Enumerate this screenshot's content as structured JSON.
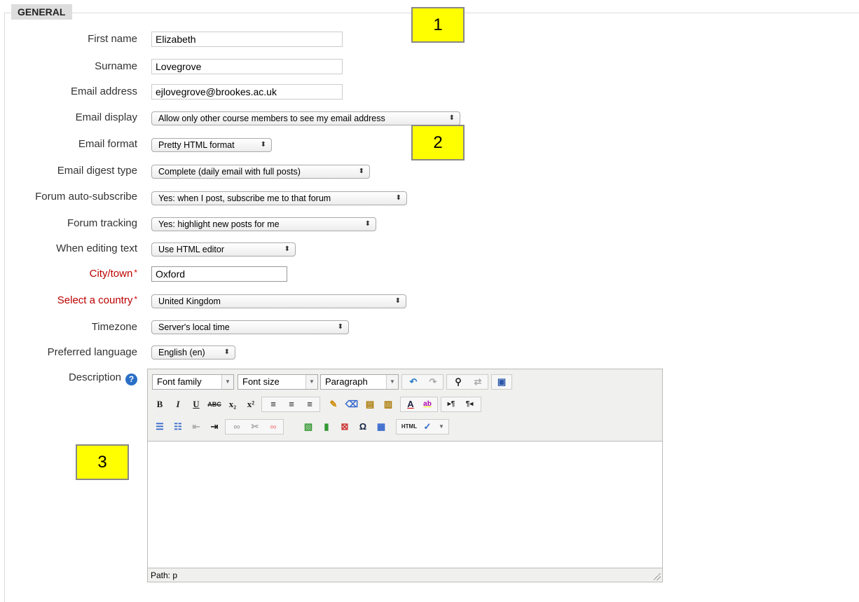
{
  "section": {
    "legend": "GENERAL"
  },
  "fields": {
    "first_name": {
      "label": "First name",
      "value": "Elizabeth"
    },
    "surname": {
      "label": "Surname",
      "value": "Lovegrove"
    },
    "email": {
      "label": "Email address",
      "value": "ejlovegrove@brookes.ac.uk"
    },
    "email_display": {
      "label": "Email display",
      "value": "Allow only other course members to see my email address"
    },
    "email_format": {
      "label": "Email format",
      "value": "Pretty HTML format"
    },
    "digest": {
      "label": "Email digest type",
      "value": "Complete (daily email with full posts)"
    },
    "autosub": {
      "label": "Forum auto-subscribe",
      "value": "Yes: when I post, subscribe me to that forum"
    },
    "tracking": {
      "label": "Forum tracking",
      "value": "Yes: highlight new posts for me"
    },
    "editing": {
      "label": "When editing text",
      "value": "Use HTML editor"
    },
    "city": {
      "label": "City/town",
      "value": "Oxford",
      "required_mark": "*"
    },
    "country": {
      "label": "Select a country",
      "value": "United Kingdom",
      "required_mark": "*"
    },
    "timezone": {
      "label": "Timezone",
      "value": "Server's local time"
    },
    "language": {
      "label": "Preferred language",
      "value": "English (en)"
    },
    "description": {
      "label": "Description",
      "help_icon": "?"
    }
  },
  "editor": {
    "font_family": "Font family",
    "font_size": "Font size",
    "format": "Paragraph",
    "path": "Path: p",
    "buttons": {
      "bold": "B",
      "italic": "I",
      "underline": "U",
      "strike": "ABC",
      "subscript": "x₂",
      "superscript": "x²",
      "omega": "Ω",
      "html": "HTML"
    }
  },
  "notes": {
    "n1": "1",
    "n2": "2",
    "n3": "3"
  },
  "colors": {
    "required": "#b00000",
    "note": "#ffff00",
    "help": "#2a6fc6"
  }
}
